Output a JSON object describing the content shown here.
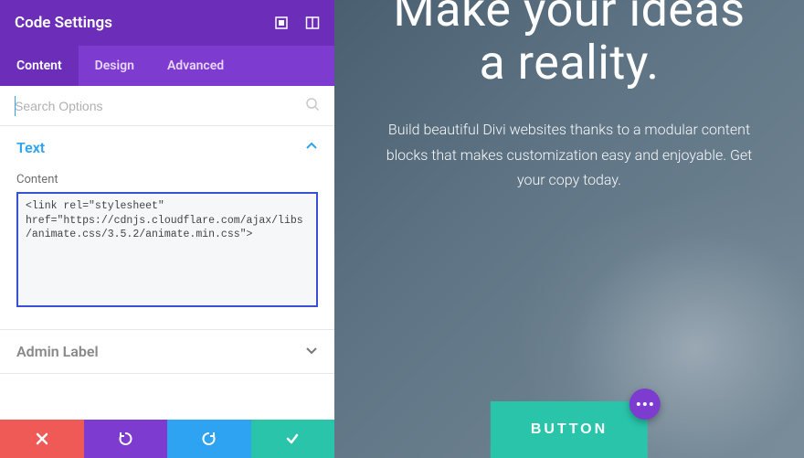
{
  "header": {
    "title": "Code Settings"
  },
  "tabs": {
    "content": "Content",
    "design": "Design",
    "advanced": "Advanced"
  },
  "search": {
    "placeholder": "Search Options"
  },
  "sections": {
    "text": {
      "title": "Text",
      "content_label": "Content",
      "code": "<link rel=\"stylesheet\" href=\"https://cdnjs.cloudflare.com/ajax/libs/animate.css/3.5.2/animate.min.css\">"
    },
    "admin": {
      "title": "Admin Label"
    }
  },
  "preview": {
    "heading": "Make your ideas a reality.",
    "subtext": "Build beautiful Divi websites thanks to a modular content blocks that makes customization easy and enjoyable. Get your copy today.",
    "button": "BUTTON"
  },
  "colors": {
    "accent_purple": "#7e3bd0",
    "accent_dark_purple": "#6c2eb9",
    "accent_blue": "#2ea3f2",
    "accent_green": "#29c4a9",
    "accent_red": "#ef5a56"
  }
}
